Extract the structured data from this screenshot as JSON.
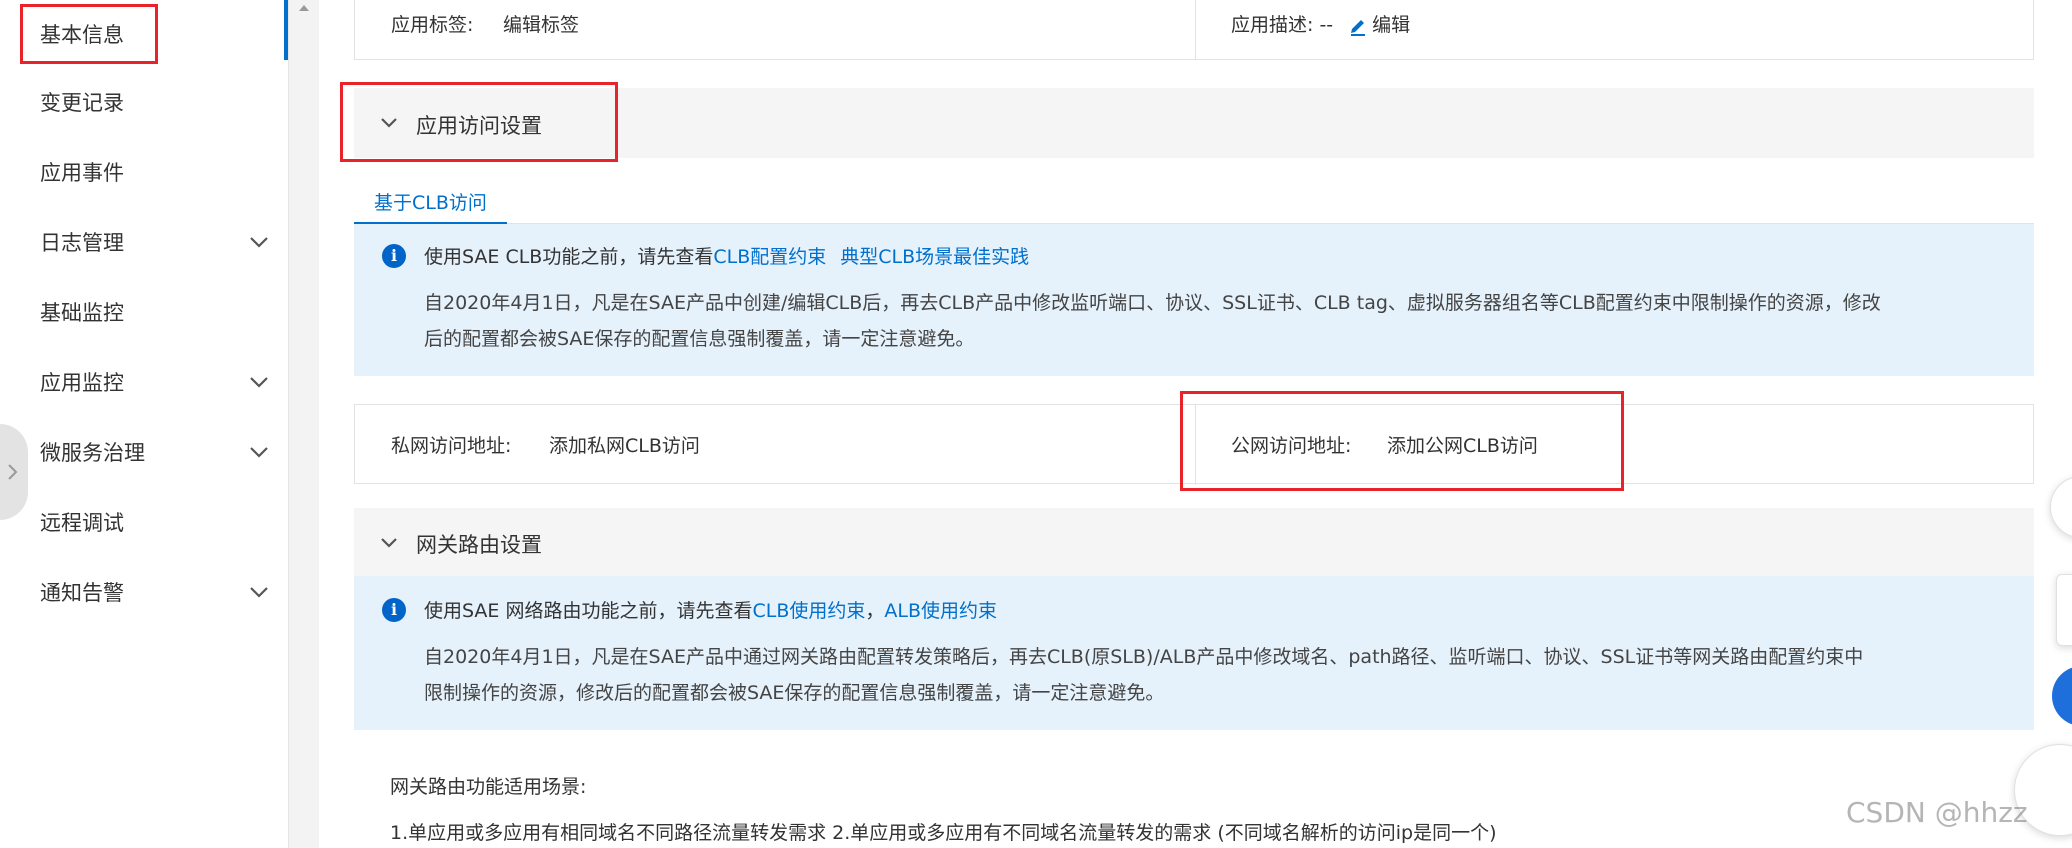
{
  "sidebar": {
    "items": [
      {
        "label": "基本信息",
        "expandable": false,
        "active": true
      },
      {
        "label": "变更记录",
        "expandable": false
      },
      {
        "label": "应用事件",
        "expandable": false
      },
      {
        "label": "日志管理",
        "expandable": true
      },
      {
        "label": "基础监控",
        "expandable": false
      },
      {
        "label": "应用监控",
        "expandable": true
      },
      {
        "label": "微服务治理",
        "expandable": true
      },
      {
        "label": "远程调试",
        "expandable": false
      },
      {
        "label": "通知告警",
        "expandable": true
      }
    ]
  },
  "app_info": {
    "tags_label": "应用标签:",
    "tags_link": "编辑标签",
    "desc_label": "应用描述: --",
    "desc_edit": "编辑"
  },
  "access_section": {
    "title": "应用访问设置",
    "tab": "基于CLB访问",
    "notice_prefix": "使用SAE CLB功能之前，请先查看",
    "notice_link1": "CLB配置约束",
    "notice_link2": "典型CLB场景最佳实践",
    "notice_line1": "自2020年4月1日，凡是在SAE产品中创建/编辑CLB后，再去CLB产品中修改监听端口、协议、SSL证书、CLB tag、虚拟服务器组名等CLB配置约束中限制操作的资源，修改",
    "notice_line2": "后的配置都会被SAE保存的配置信息强制覆盖，请一定注意避免。",
    "private_label": "私网访问地址:",
    "private_link": "添加私网CLB访问",
    "public_label": "公网访问地址:",
    "public_link": "添加公网CLB访问"
  },
  "gateway_section": {
    "title": "网关路由设置",
    "notice_prefix": "使用SAE 网络路由功能之前，请先查看",
    "notice_link1": "CLB使用约束",
    "notice_sep": "，",
    "notice_link2": "ALB使用约束",
    "notice_line1": "自2020年4月1日，凡是在SAE产品中通过网关路由配置转发策略后，再去CLB(原SLB)/ALB产品中修改域名、path路径、监听端口、协议、SSL证书等网关路由配置约束中",
    "notice_line2": "限制操作的资源，修改后的配置都会被SAE保存的配置信息强制覆盖，请一定注意避免。",
    "scenario_title": "网关路由功能适用场景:",
    "scenario_line": "1.单应用或多应用有相同域名不同路径流量转发需求 2.单应用或多应用有不同域名流量转发的需求 (不同域名解析的访问ip是同一个)"
  },
  "watermark": "CSDN @hhzz",
  "colors": {
    "link": "#0070cc",
    "highlight_box": "#e8242a",
    "info_bg": "#e6f2fb",
    "info_icon": "#0064c8"
  }
}
